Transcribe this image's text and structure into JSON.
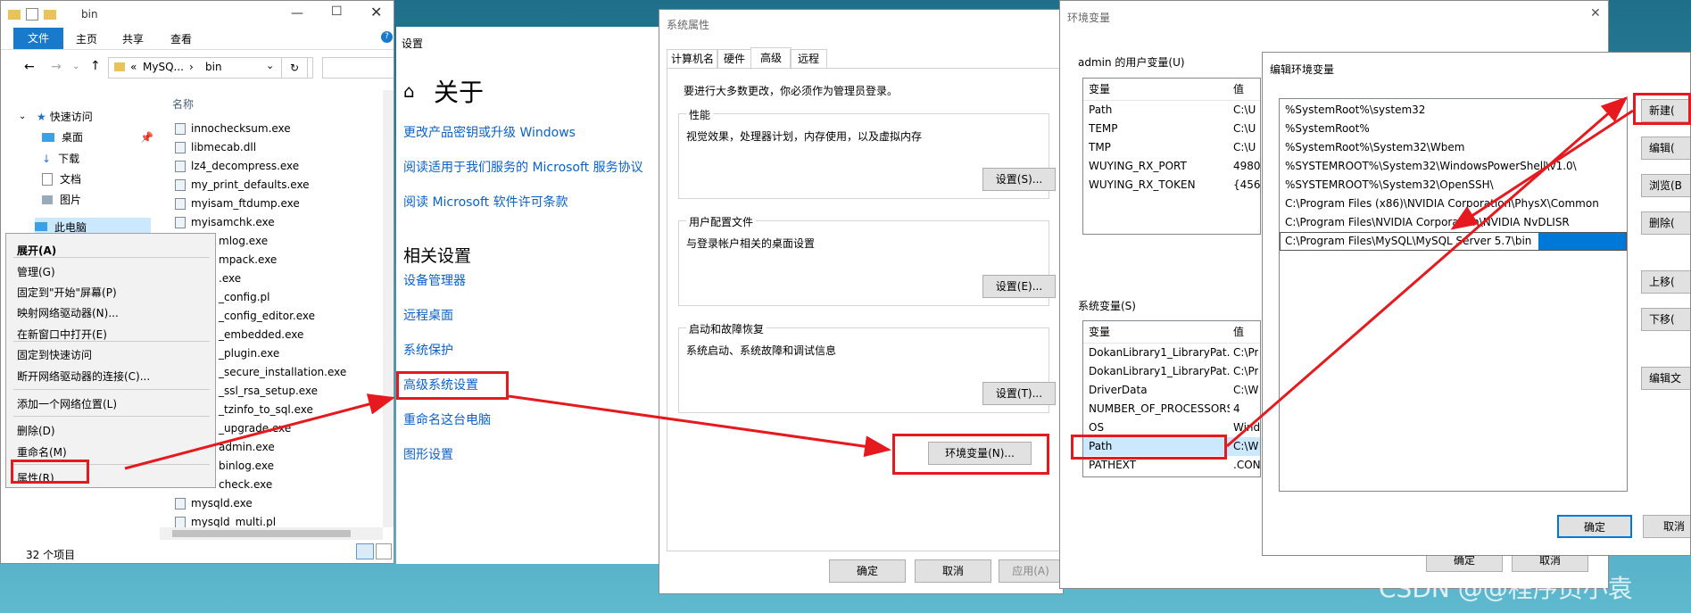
{
  "explorer": {
    "title": "bin",
    "ribbon_tabs": [
      "文件",
      "主页",
      "共享",
      "查看"
    ],
    "address": [
      "MySQ...",
      "bin"
    ],
    "column_header": "名称",
    "quick_access": "快速访问",
    "tree": [
      "桌面",
      "下载",
      "文档",
      "图片",
      "此电脑"
    ],
    "files": [
      "innochecksum.exe",
      "libmecab.dll",
      "lz4_decompress.exe",
      "my_print_defaults.exe",
      "myisam_ftdump.exe",
      "myisamchk.exe",
      "mlog.exe",
      "mpack.exe",
      ".exe",
      "_config.pl",
      "_config_editor.exe",
      "_embedded.exe",
      "_plugin.exe",
      "_secure_installation.exe",
      "_ssl_rsa_setup.exe",
      "_tzinfo_to_sql.exe",
      "_upgrade.exe",
      "admin.exe",
      "binlog.exe",
      "check.exe",
      "mysqld.exe",
      "mysqld_multi.pl"
    ],
    "status": "32 个项目",
    "context_menu": [
      "展开(A)",
      "管理(G)",
      "固定到\"开始\"屏幕(P)",
      "映射网络驱动器(N)...",
      "在新窗口中打开(E)",
      "固定到快速访问",
      "断开网络驱动器的连接(C)...",
      "添加一个网络位置(L)",
      "删除(D)",
      "重命名(M)",
      "属性(R)"
    ]
  },
  "settings": {
    "title": "设置",
    "heading": "关于",
    "links_top": [
      "更改产品密钥或升级 Windows",
      "阅读适用于我们服务的 Microsoft 服务协议",
      "阅读 Microsoft 软件许可条款"
    ],
    "related_heading": "相关设置",
    "links_related": [
      "设备管理器",
      "远程桌面",
      "系统保护",
      "高级系统设置",
      "重命名这台电脑",
      "图形设置"
    ]
  },
  "sysprops": {
    "title": "系统属性",
    "tabs": [
      "计算机名",
      "硬件",
      "高级",
      "远程"
    ],
    "admin_note": "要进行大多数更改，你必须作为管理员登录。",
    "perf_title": "性能",
    "perf_desc": "视觉效果，处理器计划，内存使用，以及虚拟内存",
    "profile_title": "用户配置文件",
    "profile_desc": "与登录帐户相关的桌面设置",
    "startup_title": "启动和故障恢复",
    "startup_desc": "系统启动、系统故障和调试信息",
    "settings_btn_1": "设置(S)...",
    "settings_btn_2": "设置(E)...",
    "settings_btn_3": "设置(T)...",
    "env_btn": "环境变量(N)...",
    "ok": "确定",
    "cancel": "取消",
    "apply": "应用(A)"
  },
  "envvars": {
    "title": "环境变量",
    "user_group": "admin 的用户变量(U)",
    "sys_group": "系统变量(S)",
    "col_var": "变量",
    "col_val": "值",
    "user_vars": [
      {
        "name": "Path",
        "value": "C:\\U"
      },
      {
        "name": "TEMP",
        "value": "C:\\U"
      },
      {
        "name": "TMP",
        "value": "C:\\U"
      },
      {
        "name": "WUYING_RX_PORT",
        "value": "4980"
      },
      {
        "name": "WUYING_RX_TOKEN",
        "value": "{456"
      }
    ],
    "sys_vars": [
      {
        "name": "DokanLibrary1_LibraryPat...",
        "value": "C:\\Pr"
      },
      {
        "name": "DokanLibrary1_LibraryPat...",
        "value": "C:\\Pr"
      },
      {
        "name": "DriverData",
        "value": "C:\\W"
      },
      {
        "name": "NUMBER_OF_PROCESSORS",
        "value": "4"
      },
      {
        "name": "OS",
        "value": "Wind"
      },
      {
        "name": "Path",
        "value": "C:\\W"
      },
      {
        "name": "PATHEXT",
        "value": ".CON"
      }
    ],
    "ok": "确定",
    "cancel": "取消"
  },
  "edit_env": {
    "title": "编辑环境变量",
    "items": [
      "%SystemRoot%\\system32",
      "%SystemRoot%",
      "%SystemRoot%\\System32\\Wbem",
      "%SYSTEMROOT%\\System32\\WindowsPowerShell\\v1.0\\",
      "%SYSTEMROOT%\\System32\\OpenSSH\\",
      "C:\\Program Files (x86)\\NVIDIA Corporation\\PhysX\\Common",
      "C:\\Program Files\\NVIDIA Corporation\\NVIDIA NvDLISR",
      "C:\\Program Files\\MySQL\\MySQL Server 5.7\\bin"
    ],
    "buttons": [
      "新建(",
      "编辑(",
      "浏览(B",
      "删除(",
      "上移(",
      "下移(",
      "编辑文本"
    ],
    "ok": "确定",
    "cancel": "取消"
  },
  "watermark": "CSDN @@程序员小袁",
  "colors": {
    "annotation": "#e5191e",
    "link": "#0a62c9",
    "selection": "#0078d7"
  }
}
